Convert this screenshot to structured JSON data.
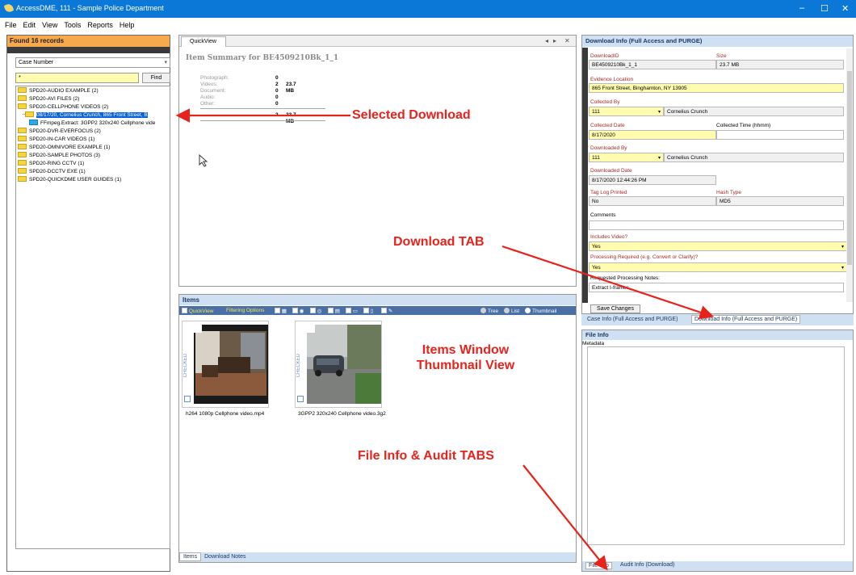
{
  "window": {
    "title": "AccessDME, 111 - Sample Police Department",
    "controls": [
      "–",
      "☐",
      "✕"
    ]
  },
  "menu": [
    "File",
    "Edit",
    "View",
    "Tools",
    "Reports",
    "Help"
  ],
  "left": {
    "header": "Found 16 records",
    "search_field": "Case Number",
    "search_value": "*",
    "find_label": "Find",
    "tree": [
      {
        "label": "SPD20-AUDIO EXAMPLE (2)"
      },
      {
        "label": "SPD20-AVI FILES (2)"
      },
      {
        "label": "SPD20-CELLPHONE VIDEOS (2)"
      },
      {
        "label": "08/17/20, Cornelius Crunch, 865 Front Street, B"
      },
      {
        "label": "FFmpeg.Extract: 3GPP2 320x240 Cellphone vide"
      },
      {
        "label": "SPD20-DVR-EVERFOCUS (2)"
      },
      {
        "label": "SPD20-IN-CAR VIDEOS (1)"
      },
      {
        "label": "SPD20-OMNIVORE EXAMPLE (1)"
      },
      {
        "label": "SPD20-SAMPLE PHOTOS (3)"
      },
      {
        "label": "SPD20-RING CCTV (1)"
      },
      {
        "label": "SPD20-DCCTV EXE (1)"
      },
      {
        "label": "SPD20-QUICKDME USER GUIDES (1)"
      }
    ]
  },
  "quickview": {
    "tab_label": "QuickView",
    "title": "Item Summary for BE4509210Bk_1_1",
    "rows": [
      {
        "label": "Photograph:",
        "value": "0",
        "size": ""
      },
      {
        "label": "Videos:",
        "value": "2",
        "size": "23.7 MB"
      },
      {
        "label": "Document:",
        "value": "0",
        "size": ""
      },
      {
        "label": "Audio:",
        "value": "0",
        "size": ""
      },
      {
        "label": "Other:",
        "value": "0",
        "size": ""
      }
    ],
    "total_value": "2",
    "total_size": "23.7 MB"
  },
  "items": {
    "header": "Items",
    "toolbar": {
      "quickview": "QuickView",
      "filtering": "Filtering Options",
      "tree": "Tree",
      "list": "List",
      "thumbnail": "Thumbnail"
    },
    "thumbs": [
      {
        "caption": "h264 1080p Cellphone video.mp4",
        "side": "CHECKED"
      },
      {
        "caption": "3GPP2 320x240 Cellphone video.3g2",
        "side": "CHECKED"
      }
    ],
    "bottom_tabs": [
      "Items",
      "Download Notes"
    ]
  },
  "download_info": {
    "header": "Download Info (Full Access and PURGE)",
    "fields": {
      "download_id_label": "DownloadID",
      "download_id": "BE4509210Bk_1_1",
      "size_label": "Size",
      "size": "23.7 MB",
      "evidence_location_label": "Evidence Location",
      "evidence_location": "865 Front Street, Binghamton, NY 13905",
      "collected_by_label": "Collected By",
      "collected_by_id": "111",
      "collected_by_name": "Cornelius Crunch",
      "collected_date_label": "Collected Date",
      "collected_date": "8/17/2020",
      "collected_time_label": "Collected Time (hhmm)",
      "collected_time": "",
      "downloaded_by_label": "Downloaded By",
      "downloaded_by_id": "111",
      "downloaded_by_name": "Cornelius Crunch",
      "downloaded_date_label": "Downloaded Date",
      "downloaded_date": "8/17/2020 12:44:26 PM",
      "tag_log_label": "Tag Log Printed",
      "tag_log": "No",
      "hash_type_label": "Hash Type",
      "hash_type": "MD5",
      "comments_label": "Comments",
      "comments": "",
      "includes_video_label": "Includes Video?",
      "includes_video": "Yes",
      "processing_label": "Processing Required (e.g. Convert or Clarify)?",
      "processing": "Yes",
      "requested_notes_label": "Requested Processing Notes:",
      "requested_notes": "Extract I-frames"
    },
    "save_label": "Save Changes"
  },
  "right_tabs": [
    "Case Info (Full Access and PURGE)",
    "Download Info (Full Access and PURGE)"
  ],
  "file_info": {
    "header": "File Info",
    "metadata_label": "Metadata",
    "bottom_tabs": [
      "File Info",
      "Audit Info (Download)"
    ]
  },
  "annotations": {
    "selected_download": "Selected Download",
    "download_tab": "Download TAB",
    "items_window_1": "Items Window",
    "items_window_2": "Thumbnail View",
    "file_info_tabs": "File Info & Audit TABS"
  },
  "colors": {
    "titlebar": "#0b78d7",
    "left_header": "#f7a94e",
    "annotation": "#e8231c",
    "yellow_field": "#fffcb0",
    "selection": "#0a64d8"
  }
}
